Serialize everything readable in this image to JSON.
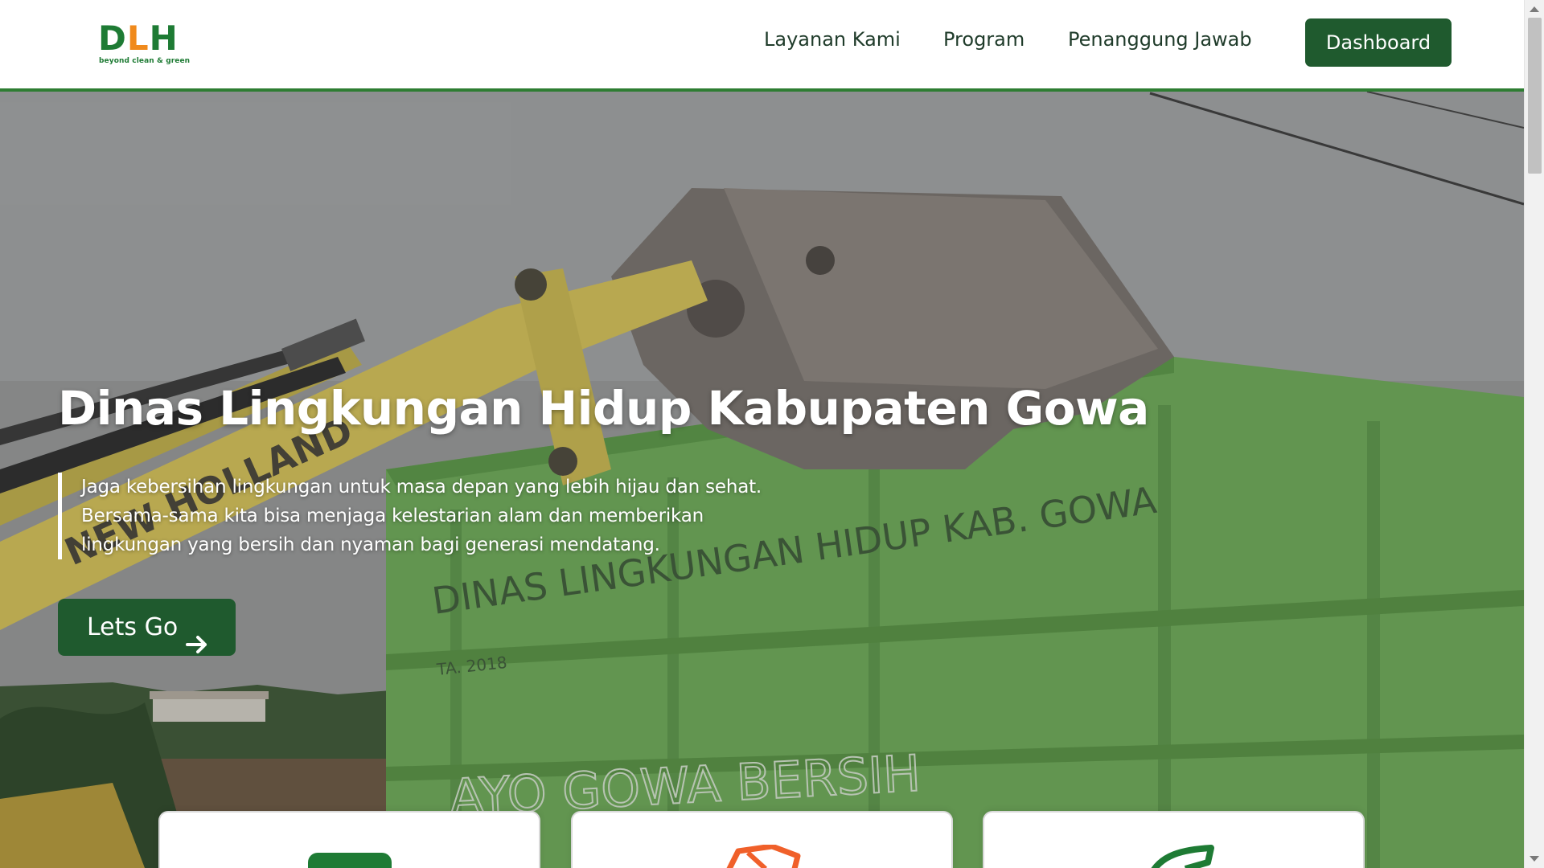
{
  "header": {
    "logo": {
      "word": "DLH",
      "tagline": "beyond clean & green"
    },
    "nav": [
      {
        "label": "Layanan Kami"
      },
      {
        "label": "Program"
      },
      {
        "label": "Penanggung Jawab"
      }
    ],
    "dashboard_label": "Dashboard"
  },
  "hero": {
    "title": "Dinas Lingkungan Hidup Kabupaten Gowa",
    "description_lines": [
      "Jaga kebersihan lingkungan untuk masa depan yang lebih hijau dan sehat.",
      "Bersama-sama kita bisa menjaga kelestarian alam dan memberikan",
      "lingkungan yang bersih dan nyaman bagi generasi mendatang."
    ],
    "cta_label": "Lets Go",
    "cta_icon": "arrow-right-icon",
    "photo_text": {
      "container_text": "DINAS LINGKUNGAN HIDUP KAB. GOWA",
      "container_year": "TA. 2018",
      "container_slogan": "AYO GOWA BERSIH",
      "excavator_text": "NEW HOLLAND"
    }
  },
  "cards": [
    {
      "icon": "green-document-icon"
    },
    {
      "icon": "orange-truck-icon"
    },
    {
      "icon": "green-leaf-icon"
    }
  ],
  "colors": {
    "brand_green": "#1f5a2e",
    "nav_border": "#2e7d32",
    "logo_orange": "#f08a1c"
  }
}
